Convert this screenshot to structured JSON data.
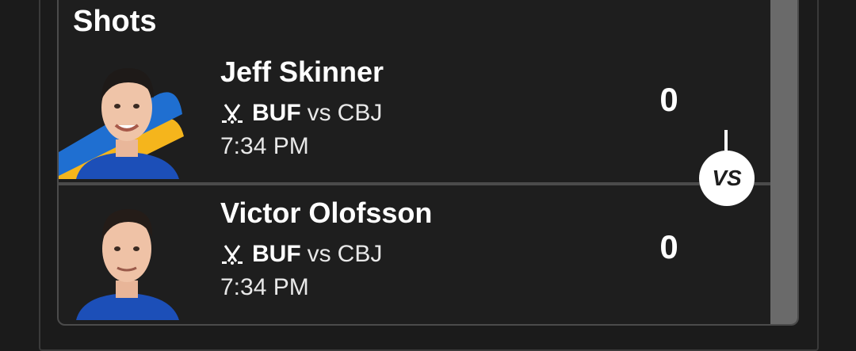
{
  "section": {
    "title": "Shots"
  },
  "players": [
    {
      "name": "Jeff Skinner",
      "team": "BUF",
      "vs": "vs",
      "opponent": "CBJ",
      "time": "7:34 PM",
      "stat": "0"
    },
    {
      "name": "Victor Olofsson",
      "team": "BUF",
      "vs": "vs",
      "opponent": "CBJ",
      "time": "7:34 PM",
      "stat": "0"
    }
  ],
  "badge": {
    "label": "VS"
  },
  "icons": {
    "sport": "hockey-sticks-icon"
  },
  "colors": {
    "background": "#1b1b1b",
    "card": "#1e1e1e",
    "team_blue": "#1f6fd1",
    "team_gold": "#f5b51c"
  }
}
